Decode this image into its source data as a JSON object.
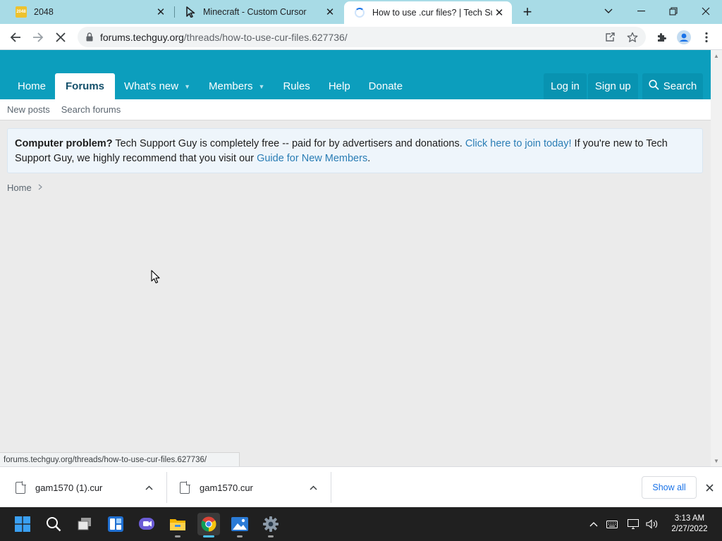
{
  "browser": {
    "tabs": [
      {
        "title": "2048",
        "favicon": "2048-favicon",
        "favicon_text": "2048",
        "active": false
      },
      {
        "title": "Minecraft - Custom Cursor",
        "favicon": "cursor-arrow-favicon",
        "active": false
      },
      {
        "title": "How to use .cur files? | Tech Supp",
        "favicon": "loading-spinner",
        "active": true
      }
    ],
    "address_bar": {
      "host": "forums.techguy.org",
      "path": "/threads/how-to-use-cur-files.627736/"
    },
    "status_url": "forums.techguy.org/threads/how-to-use-cur-files.627736/"
  },
  "site": {
    "brand_color": "#0c9ebd",
    "nav": [
      {
        "label": "Home",
        "active": false,
        "dropdown": false
      },
      {
        "label": "Forums",
        "active": true,
        "dropdown": false
      },
      {
        "label": "What's new",
        "active": false,
        "dropdown": true
      },
      {
        "label": "Members",
        "active": false,
        "dropdown": true
      },
      {
        "label": "Rules",
        "active": false,
        "dropdown": false
      },
      {
        "label": "Help",
        "active": false,
        "dropdown": false
      },
      {
        "label": "Donate",
        "active": false,
        "dropdown": false
      }
    ],
    "auth": {
      "login": "Log in",
      "signup": "Sign up"
    },
    "search_label": "Search",
    "subnav": [
      "New posts",
      "Search forums"
    ],
    "notice": {
      "bold": "Computer problem?",
      "text1": " Tech Support Guy is completely free -- paid for by advertisers and donations. ",
      "link1": "Click here to join today!",
      "text2": " If you're new to Tech Support Guy, we highly recommend that you visit our ",
      "link2": "Guide for New Members",
      "text3": "."
    },
    "breadcrumb": [
      "Home"
    ]
  },
  "downloads": {
    "items": [
      {
        "name": "gam1570 (1).cur"
      },
      {
        "name": "gam1570.cur"
      }
    ],
    "show_all": "Show all"
  },
  "taskbar": {
    "apps": [
      "start-icon",
      "search-icon",
      "task-view-icon",
      "widgets-icon",
      "teams-chat-icon",
      "file-explorer-icon",
      "chrome-icon",
      "photos-icon",
      "settings-icon"
    ],
    "time": "3:13 AM",
    "date": "2/27/2022"
  }
}
